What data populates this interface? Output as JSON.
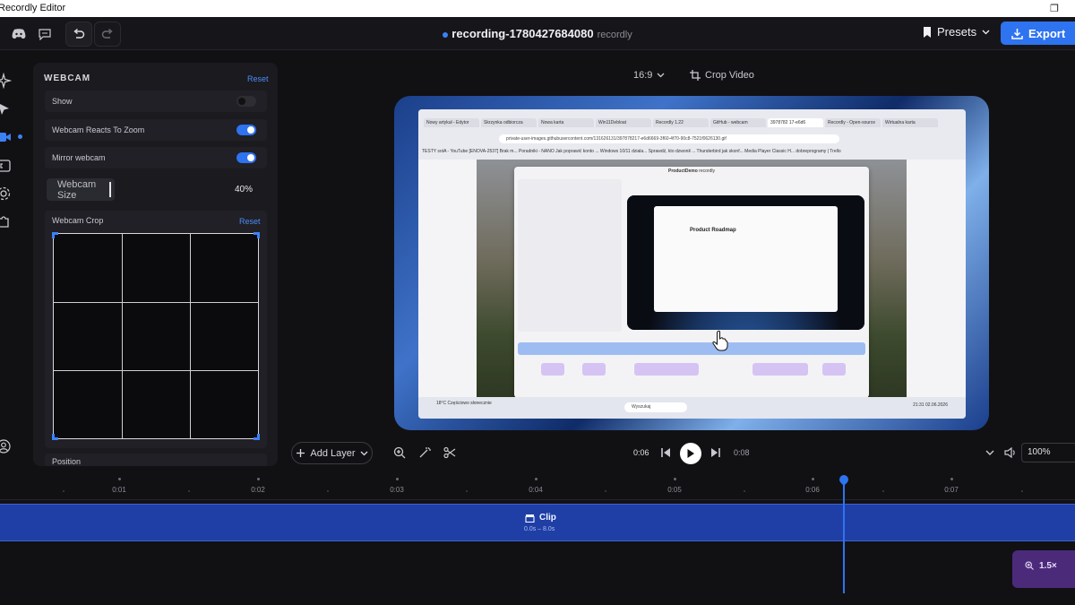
{
  "window": {
    "title": "Recordly Editor",
    "restore_glyph": "❐"
  },
  "header": {
    "recording_name": "recording-1780427684080",
    "app_name": "recordly",
    "presets_label": "Presets",
    "export_label": "Export"
  },
  "webcam_panel": {
    "heading": "WEBCAM",
    "reset_label": "Reset",
    "rows": [
      {
        "label": "Show",
        "on": false
      },
      {
        "label": "Webcam Reacts To Zoom",
        "on": true
      },
      {
        "label": "Mirror webcam",
        "on": true
      }
    ],
    "size_label": "Webcam Size",
    "size_value": "40%",
    "crop_label": "Webcam Crop",
    "crop_reset_label": "Reset",
    "position_label": "Position"
  },
  "canvas_toolbar": {
    "aspect_ratio": "16:9",
    "crop_label": "Crop Video"
  },
  "preview": {
    "browser_tabs": [
      "Nowy artykuł - Edytor",
      "Skrzynka odbiorcza",
      "Nowa karta",
      "Win11Debloat",
      "Recordly 1.22",
      "GitHub - webcam",
      "3978782 17-e6d6",
      "Recordly - Open-source",
      "Wirtualna karta"
    ],
    "url": "private-user-images.githubusercontent.com/131626131/397878217-e6d6669-3f60-4f70-90c8-7521f0626130.gif",
    "bookmarks": "TESTY   sotA - YouTube   [ENOVA-2537] Brak m...   Poradniki - NANO   Jak poprawić konto ...   Windows 10/11 dziala...   Sprawdź, kto dzwonił ...   Thunderbird jak skonf...   Media Player Classic H...   dobreprogramy | Trello",
    "inner_title": "ProductDemo",
    "inner_subtitle": "recordly",
    "doc_title": "Product Roadmap",
    "taskbar_search": "Wyszukaj",
    "taskbar_weather": "18°C  Częściowo słonecznie",
    "taskbar_clock": "21:31  02.06.2026"
  },
  "transport": {
    "add_layer_label": "Add Layer",
    "current_time": "0:06",
    "end_time": "0:08",
    "zoom_percent": "100%"
  },
  "timeline": {
    "ticks": [
      "0:01",
      "0:02",
      "0:03",
      "0:04",
      "0:05",
      "0:06",
      "0:07"
    ],
    "clip_label": "Clip",
    "clip_range": "0.0s – 8.0s",
    "zoom_segment_label": "1.5×"
  },
  "colors": {
    "accent": "#2e73f0",
    "clip_track": "#1f3fa6",
    "zoom_segment": "#4c2a7a"
  }
}
